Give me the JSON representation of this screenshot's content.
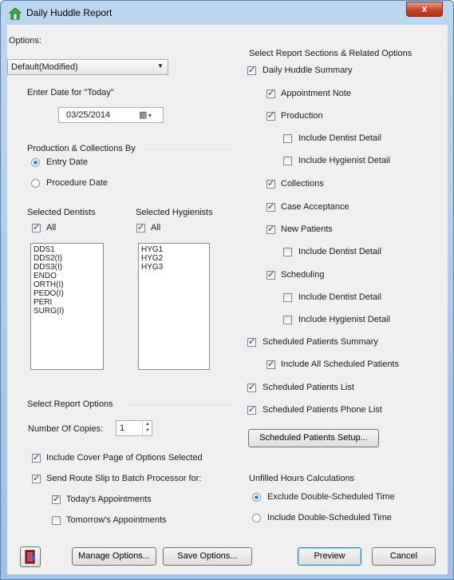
{
  "window": {
    "title": "Daily Huddle Report",
    "close_label": "x"
  },
  "options": {
    "label": "Options:",
    "selected": "Default(Modified)"
  },
  "today": {
    "label": "Enter Date for \"Today\"",
    "value": "03/25/2014"
  },
  "production": {
    "label": "Production & Collections By",
    "entry_date": "Entry Date",
    "procedure_date": "Procedure Date"
  },
  "dentists": {
    "label": "Selected Dentists",
    "all_label": "All",
    "items": [
      "DDS1",
      "DDS2(I)",
      "DDS3(I)",
      "ENDO",
      "ORTH(I)",
      "PEDO(I)",
      "PERI",
      "SURG(I)"
    ]
  },
  "hygienists": {
    "label": "Selected Hygienists",
    "all_label": "All",
    "items": [
      "HYG1",
      "HYG2",
      "HYG3"
    ]
  },
  "report_options": {
    "label": "Select Report Options",
    "copies_label": "Number Of Copies:",
    "copies_value": "1",
    "cover_page": "Include Cover Page of Options Selected",
    "route_slip": "Send Route Slip to Batch Processor for:",
    "todays": "Today's Appointments",
    "tomorrows": "Tomorrow's Appointments"
  },
  "sections": {
    "label": "Select Report Sections & Related Options",
    "daily_huddle": "Daily Huddle Summary",
    "appt_note": "Appointment Note",
    "production": "Production",
    "prod_dentist": "Include Dentist Detail",
    "prod_hygienist": "Include Hygienist Detail",
    "collections": "Collections",
    "case_acceptance": "Case Acceptance",
    "new_patients": "New Patients",
    "np_dentist": "Include Dentist Detail",
    "scheduling": "Scheduling",
    "sch_dentist": "Include Dentist Detail",
    "sch_hygienist": "Include Hygienist Detail",
    "sched_summary": "Scheduled Patients Summary",
    "include_all_sched": "Include All Scheduled Patients",
    "sched_list": "Scheduled Patients List",
    "sched_phone": "Scheduled Patients Phone List",
    "setup_button": "Scheduled Patients Setup..."
  },
  "unfilled": {
    "label": "Unfilled Hours Calculations",
    "exclude": "Exclude Double-Scheduled Time",
    "include": "Include Double-Scheduled Time"
  },
  "buttons": {
    "manage": "Manage Options...",
    "save": "Save Options...",
    "preview": "Preview",
    "cancel": "Cancel"
  }
}
